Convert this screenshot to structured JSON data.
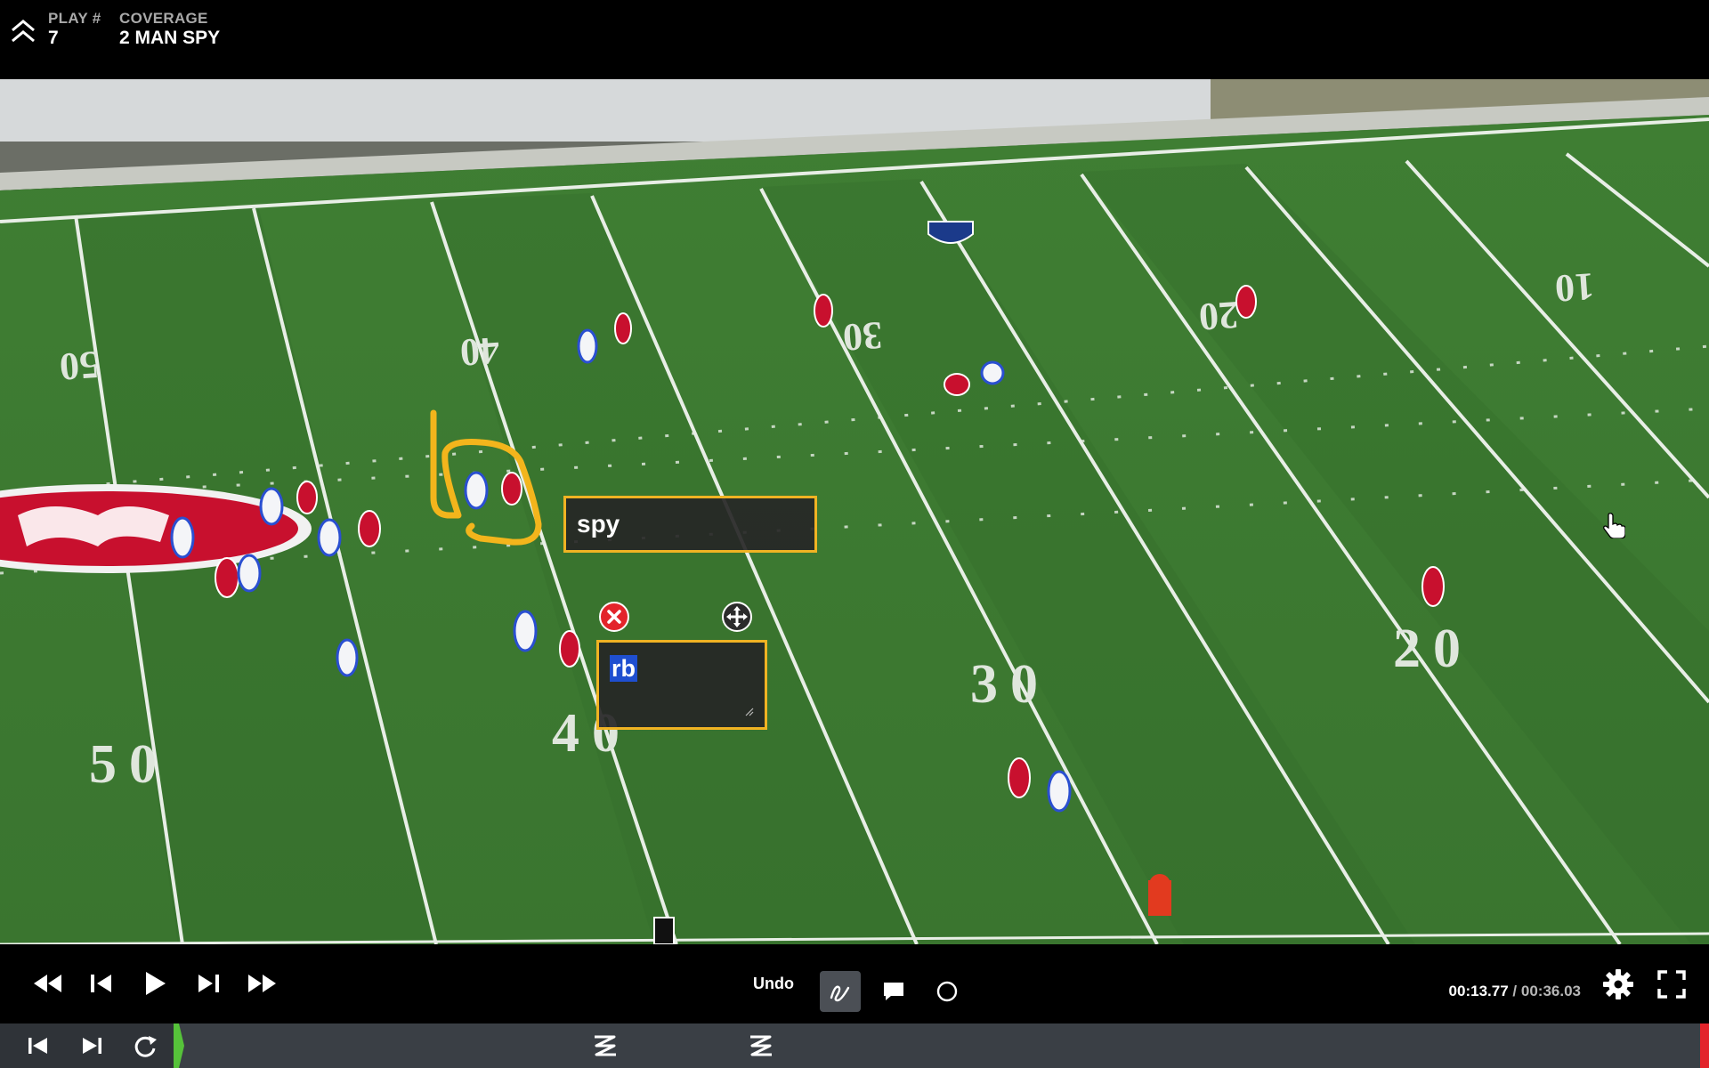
{
  "header": {
    "play_label": "PLAY #",
    "play_value": "7",
    "coverage_label": "COVERAGE",
    "coverage_value": "2 MAN SPY"
  },
  "field": {
    "yard_numbers_far": [
      "50",
      "40",
      "30",
      "20",
      "10"
    ],
    "yard_numbers_near": [
      "50",
      "40",
      "30",
      "20"
    ],
    "colors": {
      "turf": "#3d7a32",
      "turf_stripe": "#356d2b",
      "lines": "#e8eee6",
      "chiefs": "#c8102e",
      "bills": "#2a4fd1"
    }
  },
  "annotations": {
    "label_text": "spy",
    "edit_text": "rb",
    "colors": {
      "border": "#f0b323",
      "selection": "#1f4fd0"
    }
  },
  "controls": {
    "undo_label": "Undo",
    "current_time": "00:13.77",
    "separator": "/",
    "total_time": "00:36.03",
    "icons": [
      "rewind-icon",
      "step-back-icon",
      "play-icon",
      "step-forward-icon",
      "fast-forward-icon",
      "draw-tool-icon",
      "comment-tool-icon",
      "circle-tool-icon",
      "settings-icon",
      "fullscreen-icon"
    ]
  },
  "timeline": {
    "icons": [
      "skip-start-icon",
      "skip-end-icon",
      "loop-icon"
    ]
  }
}
